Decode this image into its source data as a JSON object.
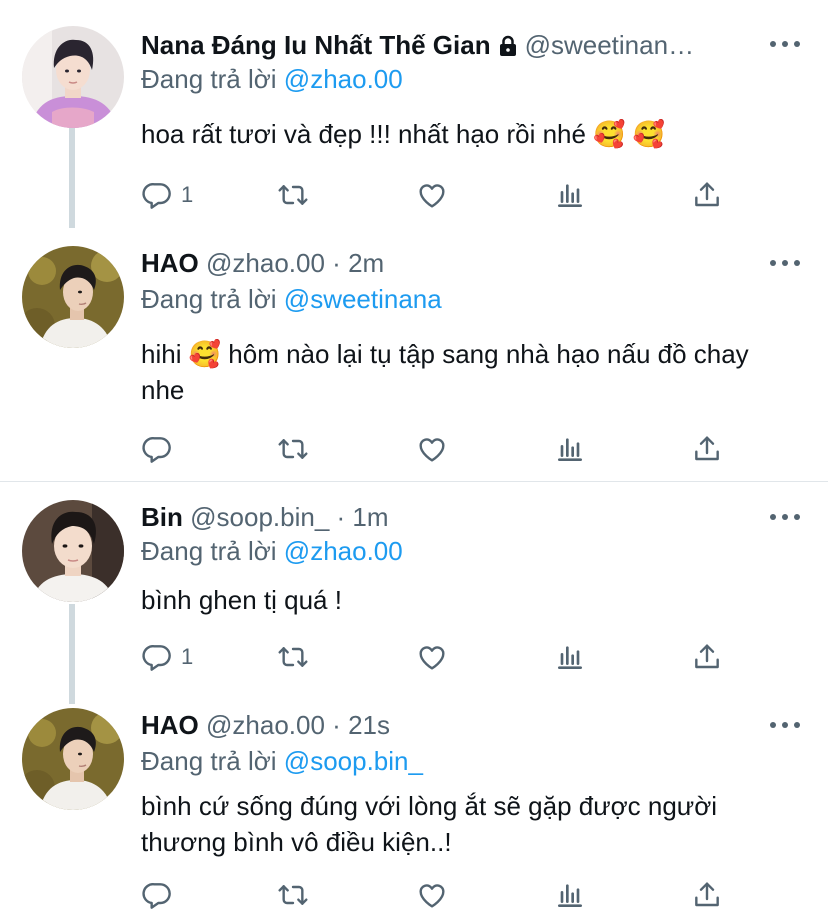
{
  "tweets": [
    {
      "name": "Nana Đáng Iu Nhất Thế Gian",
      "handle": "@sweetinan…",
      "time": "",
      "reply_prefix": "Đang trả lời",
      "reply_to": "@zhao.00",
      "text": "hoa rất tươi và đẹp !!! nhất hạo rồi nhé 🥰 🥰",
      "reply_count": "1",
      "avatar_icon": "avatar-person-purple-shirt"
    },
    {
      "name": "HAO",
      "handle": "@zhao.00",
      "time": "2m",
      "reply_prefix": "Đang trả lời",
      "reply_to": "@sweetinana",
      "text": "hihi 🥰  hôm nào lại tụ tập sang nhà hạo nấu đồ chay nhe",
      "reply_count": "",
      "avatar_icon": "avatar-person-white-shirt"
    },
    {
      "name": "Bin",
      "handle": "@soop.bin_",
      "time": "1m",
      "reply_prefix": "Đang trả lời",
      "reply_to": "@zhao.00",
      "text": "bình ghen tị quá !",
      "reply_count": "1",
      "avatar_icon": "avatar-person-selfie"
    },
    {
      "name": "HAO",
      "handle": "@zhao.00",
      "time": "21s",
      "reply_prefix": "Đang trả lời",
      "reply_to": "@soop.bin_",
      "text": "bình cứ sống đúng với lòng ắt sẽ gặp được người thương bình vô điều kiện..!",
      "reply_count": "",
      "avatar_icon": "avatar-person-white-shirt"
    }
  ],
  "separator": "·",
  "colors": {
    "link": "#1d9bf0",
    "secondary": "#536471",
    "text": "#0f1419",
    "thread_line": "#cfd9de"
  },
  "icons": [
    "reply-icon",
    "retweet-icon",
    "like-icon",
    "analytics-icon",
    "share-icon",
    "more-icon",
    "lock-icon"
  ]
}
